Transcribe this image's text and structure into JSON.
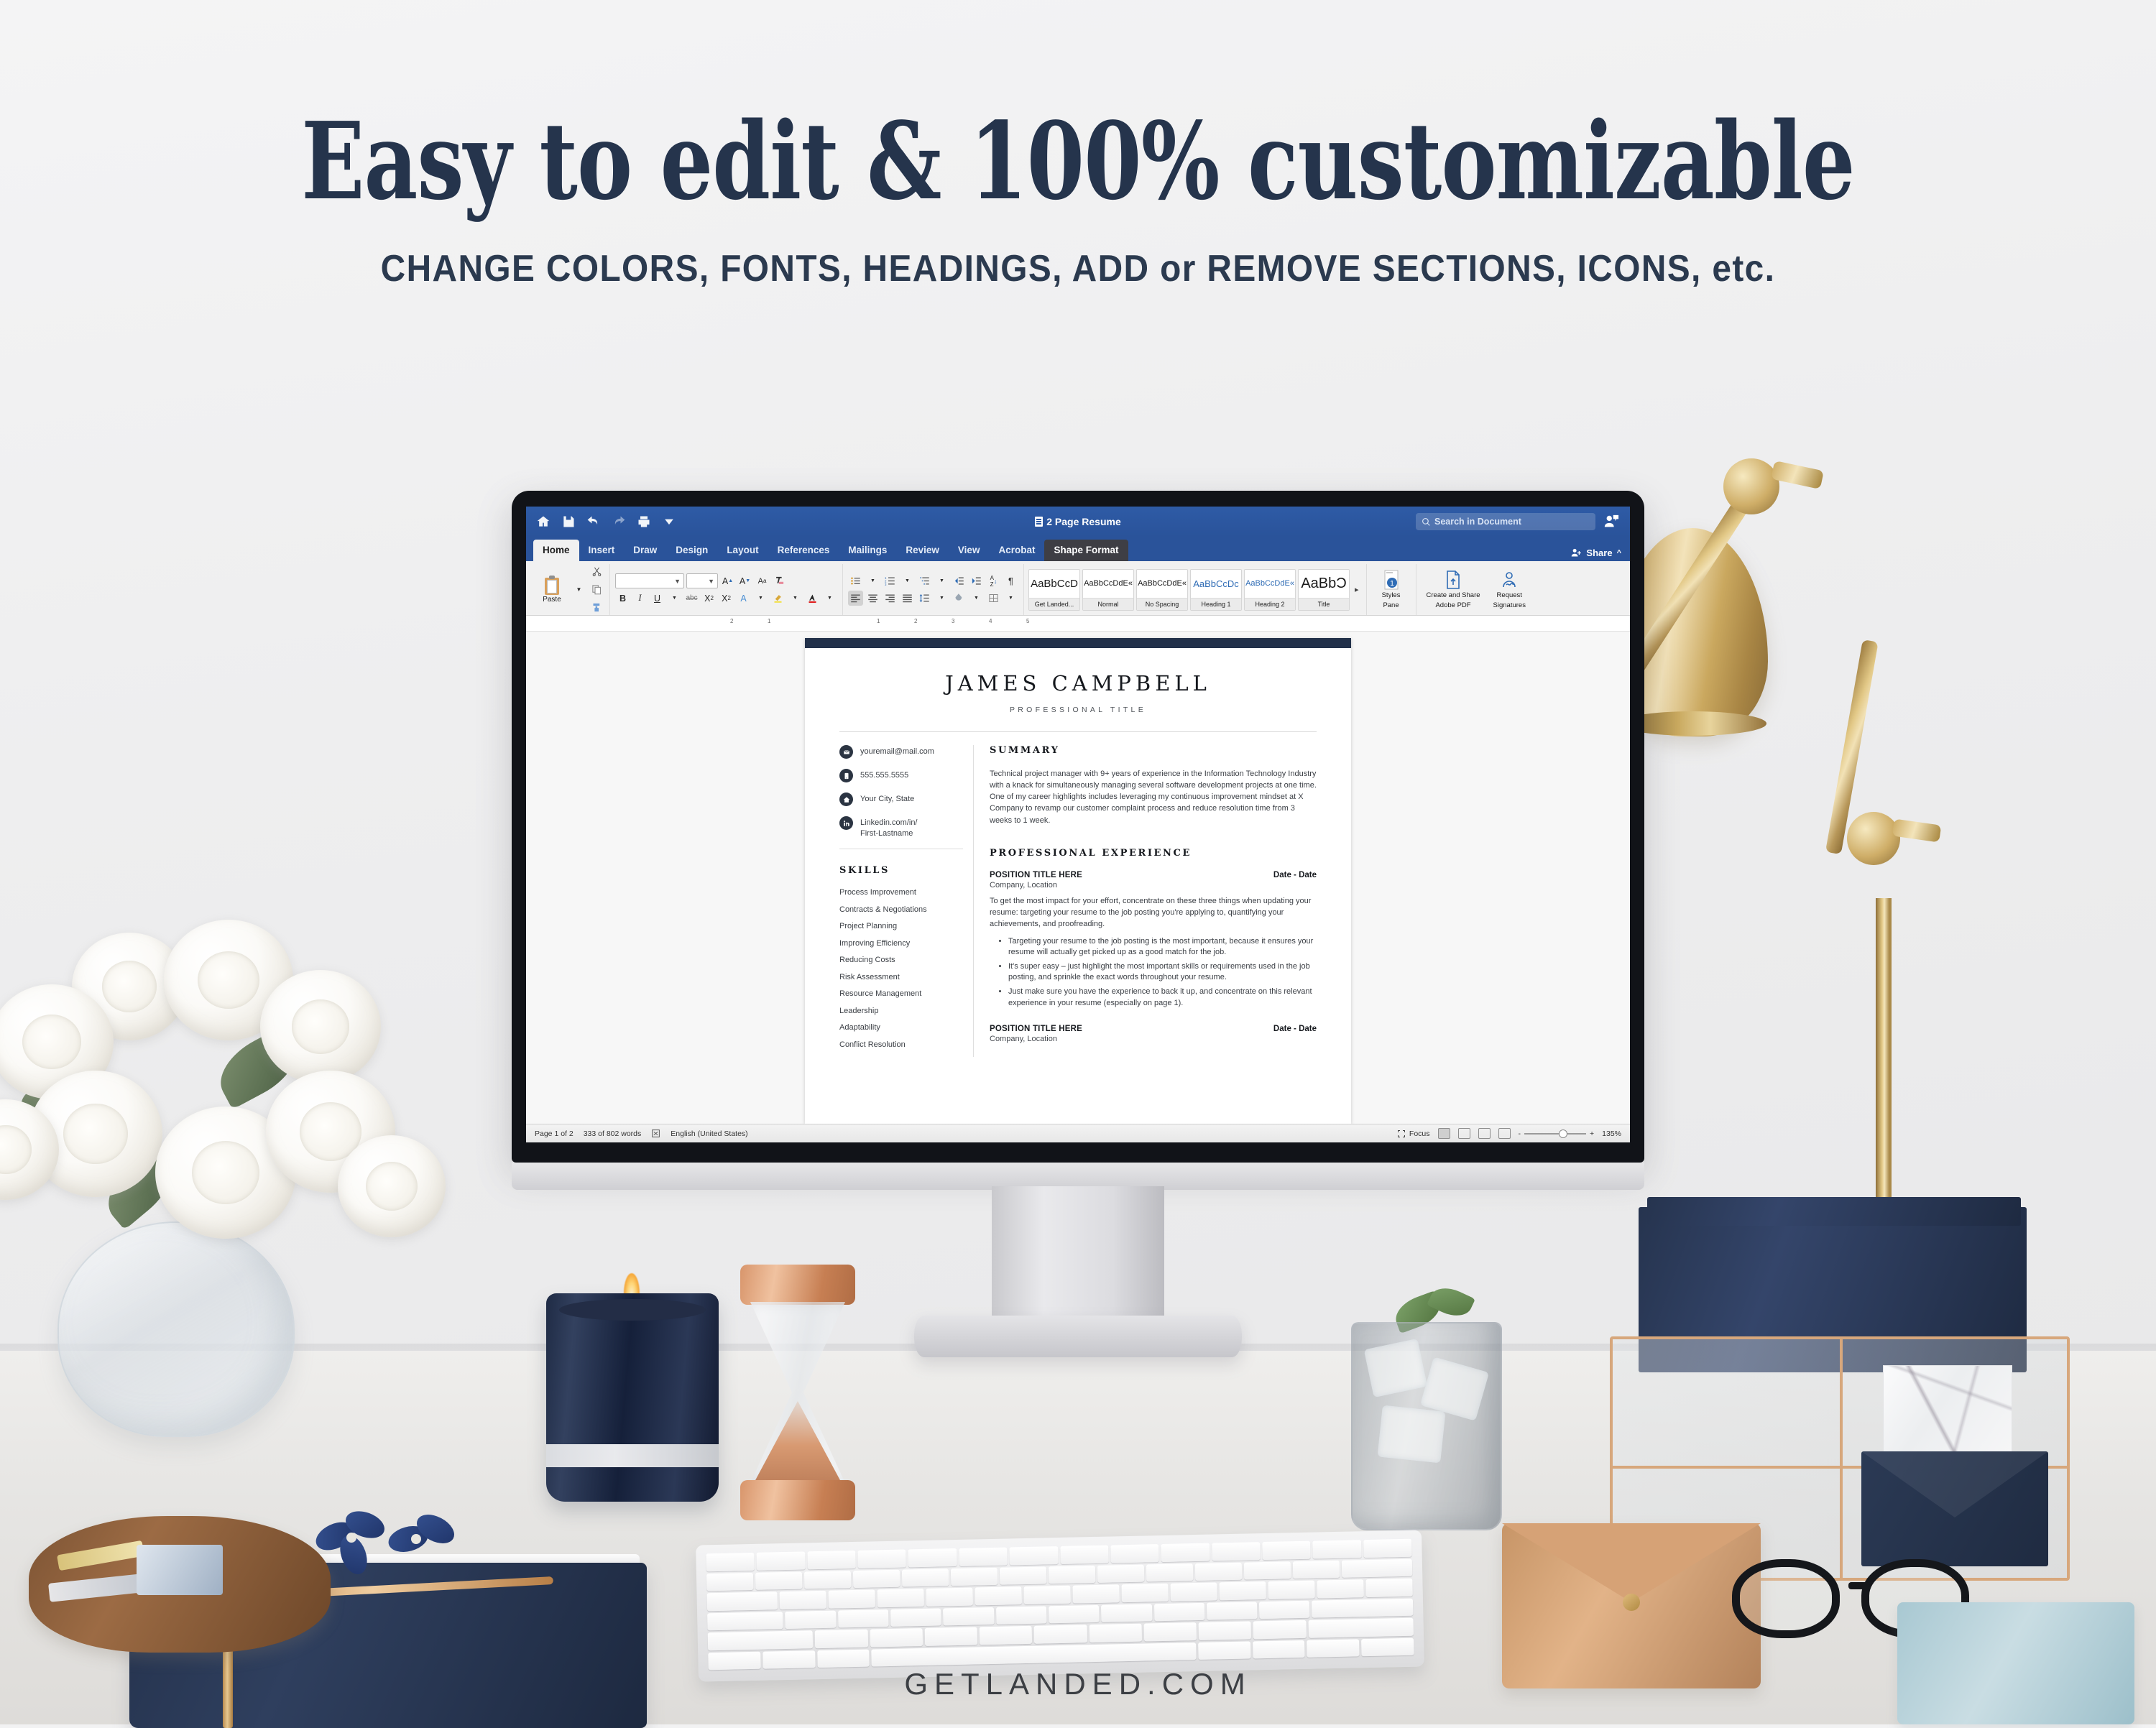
{
  "promo": {
    "headline": "Easy to edit & 100% customizable",
    "subheadline": "CHANGE COLORS, FONTS, HEADINGS, ADD or REMOVE SECTIONS, ICONS, etc.",
    "watermark": "GETLANDED.COM",
    "headline_color": "#25344c",
    "background_color": "#f2f2f3"
  },
  "word": {
    "document_title": "2 Page Resume",
    "quick_access": [
      "home-icon",
      "save-icon",
      "undo-icon",
      "redo-icon",
      "print-icon",
      "customize-icon"
    ],
    "search_placeholder": "Search in Document",
    "share_label": "Share",
    "account_icon": "account-icon",
    "accent_color": "#2a539a",
    "tabs": [
      {
        "label": "Home",
        "state": "active"
      },
      {
        "label": "Insert",
        "state": "normal"
      },
      {
        "label": "Draw",
        "state": "normal"
      },
      {
        "label": "Design",
        "state": "normal"
      },
      {
        "label": "Layout",
        "state": "normal"
      },
      {
        "label": "References",
        "state": "normal"
      },
      {
        "label": "Mailings",
        "state": "normal"
      },
      {
        "label": "Review",
        "state": "normal"
      },
      {
        "label": "View",
        "state": "normal"
      },
      {
        "label": "Acrobat",
        "state": "normal"
      },
      {
        "label": "Shape Format",
        "state": "contextual"
      }
    ],
    "ribbon": {
      "paste_label": "Paste",
      "font_name_value": "",
      "font_size_value": "",
      "font_buttons": [
        "grow-font-icon",
        "shrink-font-icon",
        "change-case-icon",
        "clear-formatting-icon"
      ],
      "format_buttons": [
        "bold-icon",
        "italic-icon",
        "underline-icon",
        "strikethrough-icon",
        "subscript-icon",
        "superscript-icon",
        "text-effects-icon",
        "highlight-icon",
        "font-color-icon"
      ],
      "paragraph_buttons": [
        "bullets-icon",
        "numbering-icon",
        "multilevel-list-icon",
        "decrease-indent-icon",
        "increase-indent-icon",
        "sort-icon",
        "show-marks-icon",
        "align-left-icon",
        "align-center-icon",
        "align-right-icon",
        "justify-icon",
        "line-spacing-icon",
        "shading-icon",
        "borders-icon"
      ],
      "styles": [
        {
          "preview": "AaBbCcD",
          "name": "Get Landed...",
          "variant": "plain"
        },
        {
          "preview": "AaBbCcDdE«",
          "name": "Normal",
          "variant": "small"
        },
        {
          "preview": "AaBbCcDdE«",
          "name": "No Spacing",
          "variant": "small"
        },
        {
          "preview": "AaBbCcDc",
          "name": "Heading 1",
          "variant": "blue"
        },
        {
          "preview": "AaBbCcDdE«",
          "name": "Heading 2",
          "variant": "blue-small"
        },
        {
          "preview": "AaBbƆ",
          "name": "Title",
          "variant": "big"
        }
      ],
      "gallery_more": "▸",
      "styles_pane_label": "Styles\nPane",
      "styles_pane_line1": "Styles",
      "styles_pane_line2": "Pane",
      "adobe_line1": "Create and Share",
      "adobe_line2": "Adobe PDF",
      "signatures_line1": "Request",
      "signatures_line2": "Signatures"
    },
    "ruler_marks": [
      "2",
      "1",
      "1",
      "2",
      "3",
      "4",
      "5"
    ],
    "status": {
      "page": "Page 1 of 2",
      "words": "333 of 802 words",
      "proofing_icon": "proofing-icon",
      "language": "English (United States)",
      "focus_label": "Focus",
      "view_icons": [
        "print-layout-icon",
        "web-layout-icon",
        "outline-icon",
        "draft-icon"
      ],
      "zoom_minus": "-",
      "zoom_plus": "+",
      "zoom_level": "135%"
    }
  },
  "resume": {
    "name": "JAMES CAMPBELL",
    "title": "PROFESSIONAL TITLE",
    "contact": [
      {
        "icon": "email-icon",
        "text": "youremail@mail.com"
      },
      {
        "icon": "phone-icon",
        "text": "555.555.5555"
      },
      {
        "icon": "home-icon",
        "text": "Your City, State"
      },
      {
        "icon": "linkedin-icon",
        "text": "Linkedin.com/in/\nFirst-Lastname"
      },
      {
        "icon": "linkedin-icon",
        "line1": "Linkedin.com/in/",
        "line2": "First-Lastname"
      }
    ],
    "skills_heading": "SKILLS",
    "skills": [
      "Process Improvement",
      "Contracts & Negotiations",
      "Project Planning",
      "Improving Efficiency",
      "Reducing Costs",
      "Risk Assessment",
      "Resource Management",
      "Leadership",
      "Adaptability",
      "Conflict Resolution"
    ],
    "summary_heading": "SUMMARY",
    "summary_text": "Technical project manager with 9+ years of experience in the Information Technology Industry with a knack for simultaneously managing several software development projects at one time. One of my career highlights includes leveraging my continuous improvement mindset at X Company to revamp our customer complaint process and reduce resolution time from 3 weeks to 1 week.",
    "experience_heading": "PROFESSIONAL EXPERIENCE",
    "experience": [
      {
        "position": "POSITION TITLE HERE",
        "date": "Date - Date",
        "company": "Company, Location",
        "paragraph": "To get the most impact for your effort, concentrate on these three things when updating your resume: targeting your resume to the job posting you're applying to, quantifying your achievements, and proofreading.",
        "bullets": [
          "Targeting your resume to the job posting is the most important, because it ensures your resume will actually get picked up as a good match for the job.",
          "It's super easy – just highlight the most important skills or requirements used in the job posting, and sprinkle the exact words throughout your resume.",
          "Just make sure you have the experience to back it up, and concentrate on this relevant experience in your resume (especially on page 1)."
        ]
      },
      {
        "position": "POSITION TITLE HERE",
        "date": "Date - Date",
        "company": "Company, Location",
        "paragraph": "",
        "bullets": []
      }
    ],
    "accent_bar_color": "#22314a"
  },
  "scene": {
    "objects": [
      "white-roses-vase",
      "navy-candle",
      "copper-hourglass",
      "water-glass-mint",
      "brass-desk-lamp",
      "glass-desk-organizer",
      "navy-notebook",
      "wood-tray",
      "black-glasses",
      "tan-leather-pouch",
      "apple-keyboard",
      "imac-monitor"
    ]
  }
}
